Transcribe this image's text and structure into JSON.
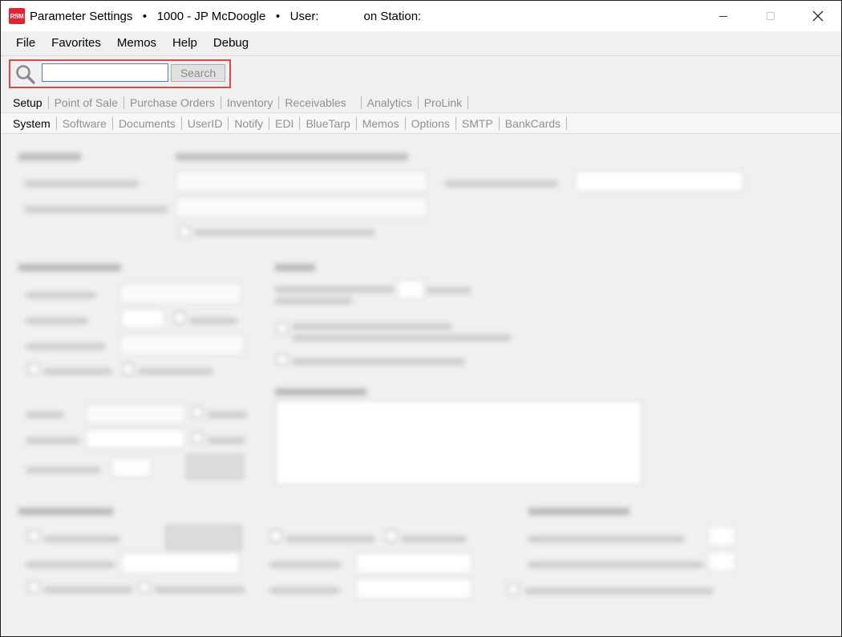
{
  "titlebar": {
    "app_icon_label": "RSM",
    "title": "Parameter Settings",
    "sep1": "•",
    "company": "1000 - JP McDoogle",
    "sep2": "•",
    "user_label": "User:",
    "station_label": "on Station:"
  },
  "window_controls": {
    "minimize_icon": "minimize-icon",
    "maximize_icon": "maximize-icon",
    "close_icon": "close-icon"
  },
  "menu": {
    "items": [
      {
        "label": "File"
      },
      {
        "label": "Favorites"
      },
      {
        "label": "Memos"
      },
      {
        "label": "Help"
      },
      {
        "label": "Debug"
      }
    ]
  },
  "search": {
    "icon": "search-icon",
    "value": "",
    "button_label": "Search",
    "highlight_color": "#e04848"
  },
  "primary_tabs": [
    {
      "label": "Setup",
      "active": true
    },
    {
      "label": "Point of Sale",
      "active": false
    },
    {
      "label": "Purchase Orders",
      "active": false
    },
    {
      "label": "Inventory",
      "active": false
    },
    {
      "label": "Receivables",
      "active": false
    },
    {
      "label": "Analytics",
      "active": false
    },
    {
      "label": "ProLink",
      "active": false
    }
  ],
  "secondary_tabs": [
    {
      "label": "System",
      "active": true
    },
    {
      "label": "Software",
      "active": false
    },
    {
      "label": "Documents",
      "active": false
    },
    {
      "label": "UserID",
      "active": false
    },
    {
      "label": "Notify",
      "active": false
    },
    {
      "label": "EDI",
      "active": false
    },
    {
      "label": "BlueTarp",
      "active": false
    },
    {
      "label": "Memos",
      "active": false
    },
    {
      "label": "Options",
      "active": false
    },
    {
      "label": "SMTP",
      "active": false
    },
    {
      "label": "BankCards",
      "active": false
    }
  ]
}
